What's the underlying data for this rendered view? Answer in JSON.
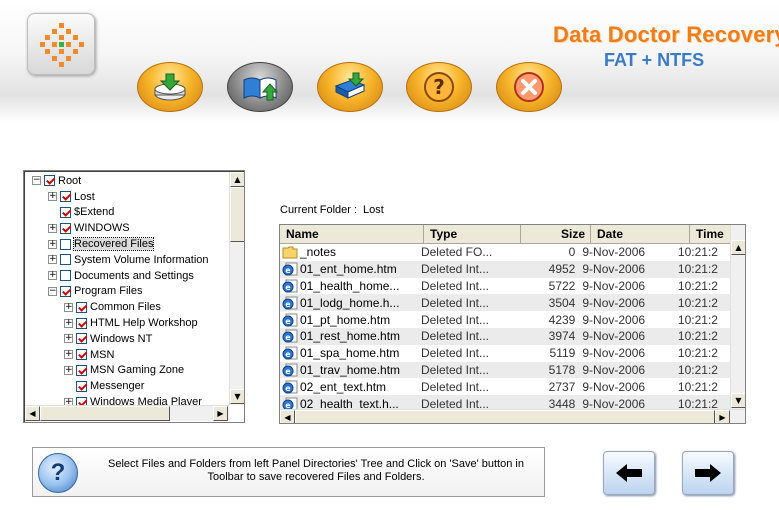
{
  "app": {
    "title": "Data Doctor Recovery",
    "subtitle": "FAT + NTFS"
  },
  "toolbar": [
    {
      "name": "save-button",
      "icon": "save-drive-icon"
    },
    {
      "name": "open-book-button",
      "icon": "open-book-icon"
    },
    {
      "name": "download-book-button",
      "icon": "download-book-icon"
    },
    {
      "name": "help-button",
      "icon": "question-icon"
    },
    {
      "name": "exit-button",
      "icon": "close-icon"
    }
  ],
  "tree": {
    "items": [
      {
        "label": "Root",
        "level": 0,
        "expander": "−",
        "checked": true
      },
      {
        "label": "Lost",
        "level": 1,
        "expander": "+",
        "checked": true
      },
      {
        "label": "$Extend",
        "level": 1,
        "expander": "",
        "checked": true
      },
      {
        "label": "WINDOWS",
        "level": 1,
        "expander": "+",
        "checked": true
      },
      {
        "label": "Recovered Files",
        "level": 1,
        "expander": "+",
        "checked": false,
        "selected": true
      },
      {
        "label": "System Volume Information",
        "level": 1,
        "expander": "+",
        "checked": false
      },
      {
        "label": "Documents and Settings",
        "level": 1,
        "expander": "+",
        "checked": false
      },
      {
        "label": "Program Files",
        "level": 1,
        "expander": "−",
        "checked": true
      },
      {
        "label": "Common Files",
        "level": 2,
        "expander": "+",
        "checked": true
      },
      {
        "label": "HTML Help Workshop",
        "level": 2,
        "expander": "+",
        "checked": true
      },
      {
        "label": "Windows NT",
        "level": 2,
        "expander": "+",
        "checked": true
      },
      {
        "label": "MSN",
        "level": 2,
        "expander": "+",
        "checked": true
      },
      {
        "label": "MSN Gaming Zone",
        "level": 2,
        "expander": "+",
        "checked": true
      },
      {
        "label": "Messenger",
        "level": 2,
        "expander": "",
        "checked": true
      },
      {
        "label": "Windows Media Player",
        "level": 2,
        "expander": "+",
        "checked": true
      }
    ]
  },
  "current_folder": {
    "label": "Current Folder  :",
    "value": "Lost"
  },
  "file_list": {
    "columns": [
      "Name",
      "Type",
      "Size",
      "Date",
      "Time"
    ],
    "rows": [
      {
        "icon": "folder-icon",
        "name": "_notes",
        "type": "Deleted FO...",
        "size": "0",
        "date": "9-Nov-2006",
        "time": "10:21:2"
      },
      {
        "icon": "ie-document-icon",
        "name": "01_ent_home.htm",
        "type": "Deleted Int...",
        "size": "4952",
        "date": "9-Nov-2006",
        "time": "10:21:2"
      },
      {
        "icon": "ie-document-icon",
        "name": "01_health_home...",
        "type": "Deleted Int...",
        "size": "5722",
        "date": "9-Nov-2006",
        "time": "10:21:2"
      },
      {
        "icon": "ie-document-icon",
        "name": "01_lodg_home.h...",
        "type": "Deleted Int...",
        "size": "3504",
        "date": "9-Nov-2006",
        "time": "10:21:2"
      },
      {
        "icon": "ie-document-icon",
        "name": "01_pt_home.htm",
        "type": "Deleted Int...",
        "size": "4239",
        "date": "9-Nov-2006",
        "time": "10:21:2"
      },
      {
        "icon": "ie-document-icon",
        "name": "01_rest_home.htm",
        "type": "Deleted Int...",
        "size": "3974",
        "date": "9-Nov-2006",
        "time": "10:21:2"
      },
      {
        "icon": "ie-document-icon",
        "name": "01_spa_home.htm",
        "type": "Deleted Int...",
        "size": "5119",
        "date": "9-Nov-2006",
        "time": "10:21:2"
      },
      {
        "icon": "ie-document-icon",
        "name": "01_trav_home.htm",
        "type": "Deleted Int...",
        "size": "5178",
        "date": "9-Nov-2006",
        "time": "10:21:2"
      },
      {
        "icon": "ie-document-icon",
        "name": "02_ent_text.htm",
        "type": "Deleted Int...",
        "size": "2737",
        "date": "9-Nov-2006",
        "time": "10:21:2"
      },
      {
        "icon": "ie-document-icon",
        "name": "02_health_text.h...",
        "type": "Deleted Int...",
        "size": "3448",
        "date": "9-Nov-2006",
        "time": "10:21:2"
      }
    ]
  },
  "status": {
    "message": "Select Files and Folders from left Panel Directories' Tree and Click on 'Save' button in Toolbar to save recovered Files and Folders.",
    "help_icon_glyph": "?"
  },
  "nav": {
    "back_icon": "arrow-left-icon",
    "next_icon": "arrow-right-icon"
  },
  "colors": {
    "title_orange": "#ee7d1b",
    "subtitle_blue": "#3a7bc7",
    "check_red": "#d00000"
  }
}
